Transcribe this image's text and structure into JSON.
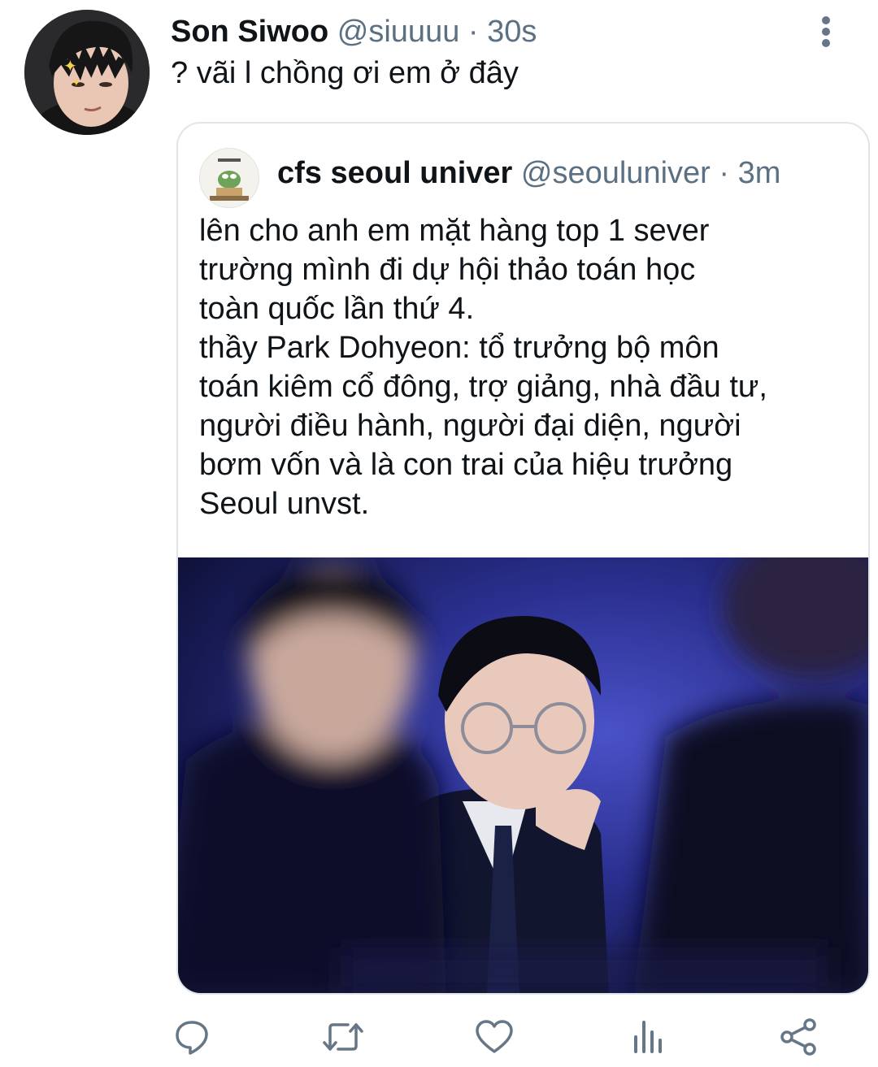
{
  "tweet": {
    "display_name": "Son Siwoo",
    "handle": "@siuuuu",
    "separator": "·",
    "time": "30s",
    "text": "? vãi l chồng ơi em ở đây",
    "avatar_icon": "user-avatar"
  },
  "quoted_tweet": {
    "display_name": "cfs seoul univer",
    "handle": "@seouluniver",
    "separator": "·",
    "time": "3m",
    "avatar_icon": "pepe-avatar",
    "lines": [
      "lên cho anh em mặt hàng top 1 sever",
      "trường mình đi dự hội thảo toán học",
      "toàn quốc lần thứ 4.",
      "thầy Park Dohyeon: tổ trưởng bộ môn",
      "toán kiêm cổ đông, trợ giảng, nhà đầu tư,",
      "người điều hành, người đại diện, người",
      "bơm vốn và là con trai của hiệu trưởng",
      "Seoul unvst."
    ],
    "photo_icon": "photo-man-in-suit-glasses"
  },
  "actions": {
    "reply_icon": "reply-icon",
    "retweet_icon": "retweet-icon",
    "like_icon": "like-icon",
    "analytics_icon": "analytics-icon",
    "share_icon": "share-icon"
  },
  "colors": {
    "text": "#0f1419",
    "secondary": "#5b7083",
    "border": "#dfe6ea",
    "icon": "#657786"
  }
}
